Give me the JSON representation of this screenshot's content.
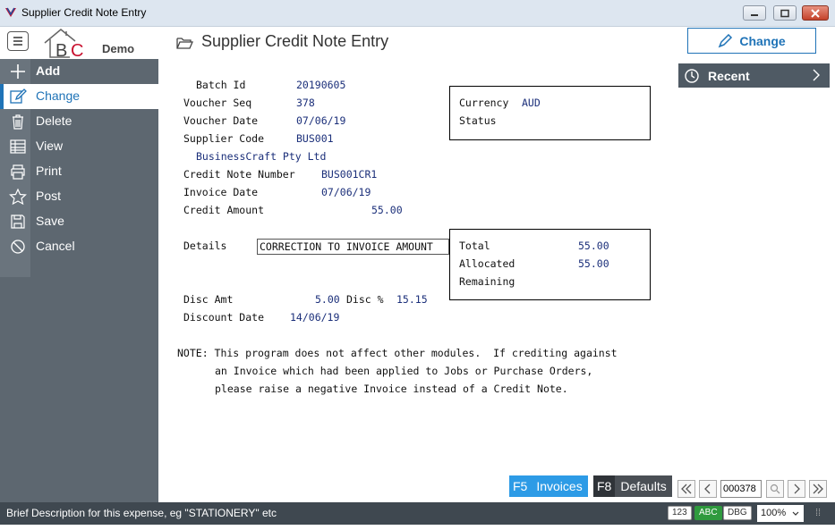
{
  "window": {
    "title": "Supplier Credit Note Entry"
  },
  "header": {
    "logo_text": "Demo",
    "page_title": "Supplier Credit Note Entry",
    "change_label": "Change"
  },
  "sidebar": {
    "items": [
      {
        "label": "Add",
        "icon": "plus-icon"
      },
      {
        "label": "Change",
        "icon": "edit-icon"
      },
      {
        "label": "Delete",
        "icon": "trash-icon"
      },
      {
        "label": "View",
        "icon": "table-icon"
      },
      {
        "label": "Print",
        "icon": "printer-icon"
      },
      {
        "label": "Post",
        "icon": "star-icon"
      },
      {
        "label": "Save",
        "icon": "save-icon"
      },
      {
        "label": "Cancel",
        "icon": "cancel-icon"
      }
    ]
  },
  "recent": {
    "label": "Recent"
  },
  "form": {
    "batch_id_label": "Batch Id",
    "batch_id": "20190605",
    "voucher_seq_label": "Voucher Seq",
    "voucher_seq": "378",
    "voucher_date_label": "Voucher Date",
    "voucher_date": "07/06/19",
    "supplier_code_label": "Supplier Code",
    "supplier_code": "BUS001",
    "supplier_name": "BusinessCraft Pty Ltd",
    "credit_note_number_label": "Credit Note Number",
    "credit_note_number": "BUS001CR1",
    "invoice_date_label": "Invoice Date",
    "invoice_date": "07/06/19",
    "credit_amount_label": "Credit Amount",
    "credit_amount": "55.00",
    "currency_label": "Currency",
    "currency": "AUD",
    "status_label": "Status",
    "details_label": "Details",
    "details": "CORRECTION TO INVOICE AMOUNT",
    "total_label": "Total",
    "total": "55.00",
    "allocated_label": "Allocated",
    "allocated": "55.00",
    "remaining_label": "Remaining",
    "disc_amt_label": "Disc Amt",
    "disc_amt": "5.00",
    "disc_pct_label": "Disc %",
    "disc_pct": "15.15",
    "discount_date_label": "Discount Date",
    "discount_date": "14/06/19",
    "note_line1": "NOTE: This program does not affect other modules.  If crediting against",
    "note_line2": "an Invoice which had been applied to Jobs or Purchase Orders,",
    "note_line3": "please raise a negative Invoice instead of a Credit Note."
  },
  "toolbar": {
    "f5_key": "F5",
    "f5_label": "Invoices",
    "f8_key": "F8",
    "f8_label": "Defaults",
    "record": "000378"
  },
  "status": {
    "message": "Brief Description for this expense, eg \"STATIONERY\" etc",
    "badge_123": "123",
    "badge_abc": "ABC",
    "badge_dbg": "DBG",
    "zoom": "100%"
  },
  "colors": {
    "accent": "#1f73b7",
    "sidebar": "#5d6770",
    "f5": "#2d9be6",
    "abc_badge": "#2f9a3e"
  }
}
